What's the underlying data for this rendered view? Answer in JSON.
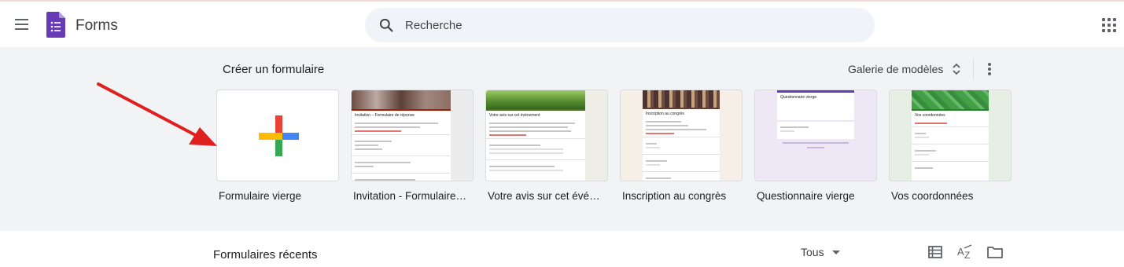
{
  "header": {
    "app_name": "Forms",
    "search_placeholder": "Recherche"
  },
  "gallery": {
    "title": "Créer un formulaire",
    "template_gallery_label": "Galerie de modèles",
    "templates": [
      {
        "label": "Formulaire vierge",
        "icon": "plus-icon"
      },
      {
        "label": "Invitation - Formulaire de réponse",
        "preview_title": "Invitation – Formulaire de réponse",
        "accent": "#a61c00"
      },
      {
        "label": "Votre avis sur cet événement",
        "preview_title": "Votre avis sur cet événement",
        "accent": "#556b2f"
      },
      {
        "label": "Inscription au congrès",
        "preview_title": "Inscription au congrès",
        "accent": "#5d4037"
      },
      {
        "label": "Questionnaire vierge",
        "preview_title": "Questionnaire vierge",
        "accent": "#673ab7"
      },
      {
        "label": "Vos coordonnées",
        "preview_title": "Vos coordonnées",
        "accent": "#2e7d32"
      }
    ]
  },
  "recent": {
    "title": "Formulaires récents",
    "owner_filter": "Tous"
  },
  "colors": {
    "brand": "#673ab7",
    "gallery_bg": "#f1f3f4",
    "search_bg": "#f0f4f9",
    "annotation_arrow": "#e02020"
  }
}
